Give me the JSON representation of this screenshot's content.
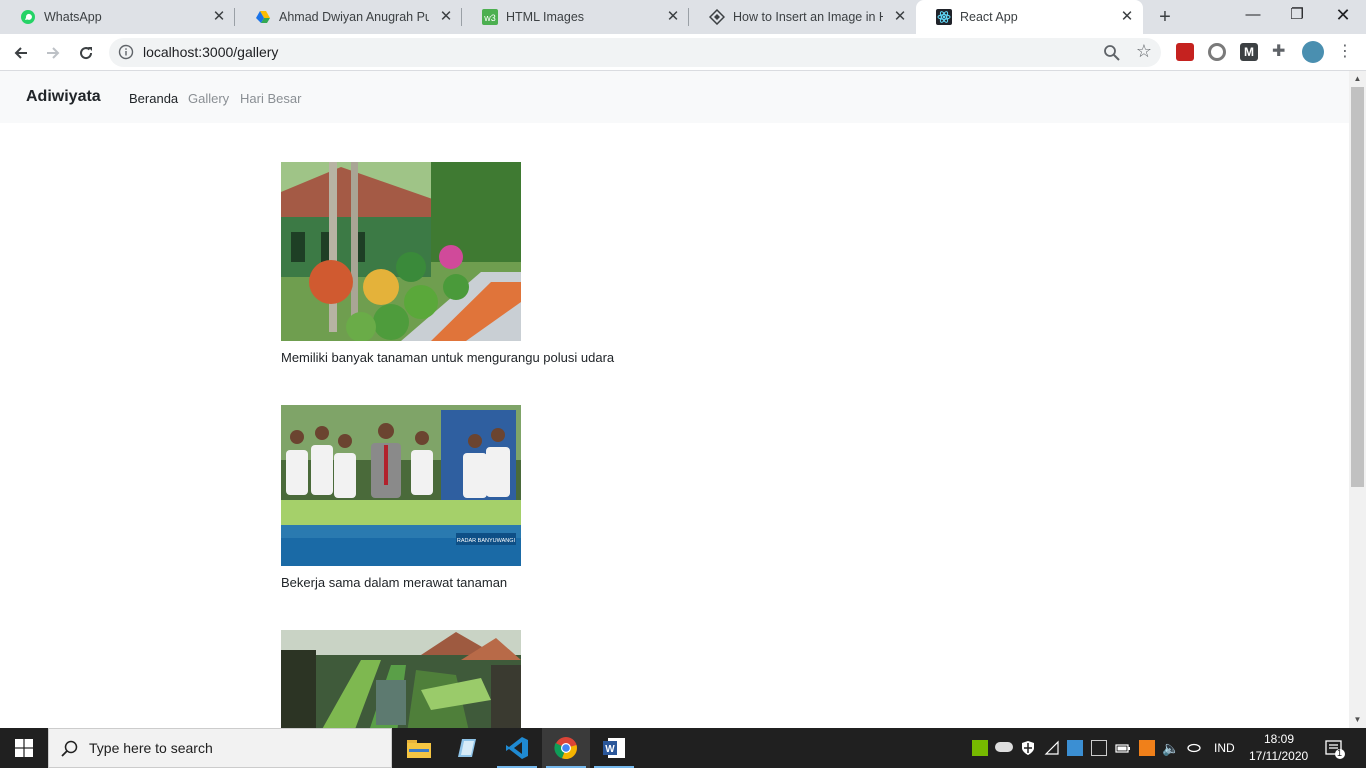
{
  "browser": {
    "tabs": [
      {
        "title": "WhatsApp",
        "icon": "whatsapp-icon",
        "color": "#25d366"
      },
      {
        "title": "Ahmad Dwiyan Anugrah Putra",
        "icon": "google-drive-icon",
        "color": "#fbbc04"
      },
      {
        "title": "HTML Images",
        "icon": "w3schools-icon",
        "color": "#4caf50"
      },
      {
        "title": "How to Insert an Image in HTML",
        "icon": "website-icon",
        "color": "#3c4043"
      },
      {
        "title": "React App",
        "icon": "react-icon",
        "color": "#61dafb"
      }
    ],
    "active_tab": 4,
    "url": "localhost:3000/gallery"
  },
  "page": {
    "brand": "Adiwiyata",
    "nav": [
      {
        "label": "Beranda",
        "state": "active"
      },
      {
        "label": "Gallery",
        "state": "muted"
      },
      {
        "label": "Hari Besar",
        "state": "muted"
      }
    ],
    "gallery": [
      {
        "caption": "Memiliki banyak tanaman untuk mengurangu polusi udara",
        "image": "school-garden-photo"
      },
      {
        "caption": "Bekerja sama dalam merawat tanaman",
        "image": "students-hydroponics-photo",
        "image_text": "RADAR BANYUWANGI"
      },
      {
        "caption": "",
        "image": "hydroponic-rooftop-photo"
      }
    ]
  },
  "taskbar": {
    "search_placeholder": "Type here to search",
    "language": "IND",
    "time": "18:09",
    "date": "17/11/2020",
    "notification_count": "1"
  },
  "colors": {
    "accent": "#76b9ed",
    "navbar_bg": "#f8f9fa",
    "nav_active": "#212529",
    "nav_muted": "#8a8f94"
  }
}
